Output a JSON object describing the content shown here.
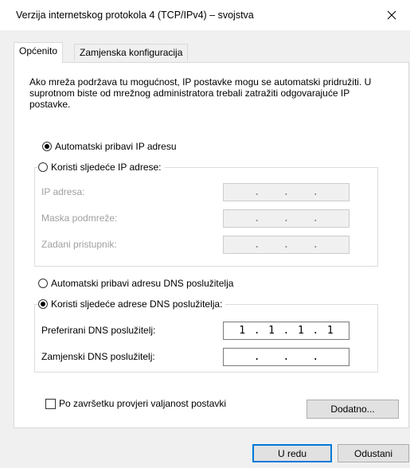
{
  "window": {
    "title": "Verzija internetskog protokola 4 (TCP/IPv4) – svojstva",
    "close_symbol": "✕"
  },
  "tabs": [
    {
      "label": "Općenito",
      "active": true
    },
    {
      "label": "Zamjenska konfiguracija",
      "active": false
    }
  ],
  "description": "Ako mreža podržava tu mogućnost, IP postavke mogu se automatski pridružiti. U suprotnom biste od mrežnog administratora trebali zatražiti odgovarajuće IP postavke.",
  "ip": {
    "auto_label": "Automatski pribavi IP adresu",
    "auto_selected": true,
    "manual_label": "Koristi sljedeće IP adrese:",
    "fields": [
      {
        "label": "IP adresa:",
        "octets": [
          "",
          "",
          "",
          ""
        ],
        "enabled": false
      },
      {
        "label": "Maska podmreže:",
        "octets": [
          "",
          "",
          "",
          ""
        ],
        "enabled": false
      },
      {
        "label": "Zadani pristupnik:",
        "octets": [
          "",
          "",
          "",
          ""
        ],
        "enabled": false
      }
    ]
  },
  "dns": {
    "auto_label": "Automatski pribavi adresu DNS poslužitelja",
    "manual_label": "Koristi sljedeće adrese DNS poslužitelja:",
    "manual_selected": true,
    "fields": [
      {
        "label": "Preferirani DNS poslužitelj:",
        "octets": [
          "1",
          "1",
          "1",
          "1"
        ],
        "enabled": true
      },
      {
        "label": "Zamjenski DNS poslužitelj:",
        "octets": [
          "",
          "",
          "",
          ""
        ],
        "enabled": true
      }
    ]
  },
  "validate": {
    "label": "Po završetku provjeri valjanost postavki",
    "checked": false
  },
  "buttons": {
    "advanced": "Dodatno...",
    "ok": "U redu",
    "cancel": "Odustani"
  },
  "colors": {
    "accent": "#0078d7",
    "disabled_text": "#a0a0a0"
  }
}
